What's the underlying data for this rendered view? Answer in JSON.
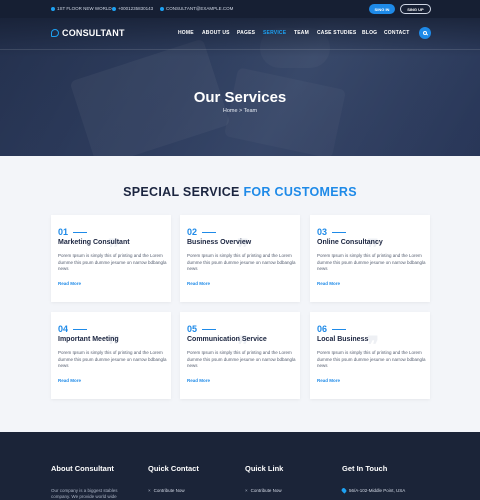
{
  "topbar": {
    "address": "1ST FLOOR NEW WORLD",
    "phone": "+0001235830143",
    "email": "CONSULTANT@EXAMPLE.COM",
    "signin_label": "SING IN",
    "signup_label": "SING UP"
  },
  "brand": {
    "name": "CONSULTANT"
  },
  "nav": {
    "items": [
      {
        "label": "HOME"
      },
      {
        "label": "ABOUT US"
      },
      {
        "label": "PAGES"
      },
      {
        "label": "SERVICE"
      },
      {
        "label": "TEAM"
      },
      {
        "label": "CASE STUDIES"
      },
      {
        "label": "BLOG"
      },
      {
        "label": "CONTACT"
      }
    ],
    "active": "SERVICE"
  },
  "hero": {
    "title": "Our Services",
    "breadcrumb": "Home > Team"
  },
  "services": {
    "title_main": "SPECIAL SERVICE ",
    "title_highlight": "FOR CUSTOMERS",
    "read_more": "Read More",
    "cards": [
      {
        "number": "01",
        "title": "Marketing Consultant",
        "description": "Porem Ipsum is simply this of printing and the Lorem dumme this psum dumme jesume on narrow bdbangla news"
      },
      {
        "number": "02",
        "title": "Business Overview",
        "description": "Porem Ipsum is simply this of printing and the Lorem dumme this psum dumme jesume on narrow bdbangla news"
      },
      {
        "number": "03",
        "title": "Online Consultancy",
        "description": "Porem Ipsum is simply this of printing and the Lorem dumme this psum dumme jesume on narrow bdbangla news"
      },
      {
        "number": "04",
        "title": "Important Meeting",
        "description": "Porem Ipsum is simply this of printing and the Lorem dumme this psum dumme jesume on narrow bdbangla news"
      },
      {
        "number": "05",
        "title": "Communication Service",
        "description": "Porem Ipsum is simply this of printing and the Lorem dumme this psum dumme jesume on narrow bdbangla news"
      },
      {
        "number": "06",
        "title": "Local Business",
        "description": "Porem Ipsum is simply this of printing and the Lorem dumme this psum dumme jesume on narrow bdbangla news"
      }
    ]
  },
  "footer": {
    "about_title": "About Consultant",
    "about_text": "Our company is a biggest stables company. We provide world wide",
    "contact_title": "Quick Contact",
    "contact_link": "Contribute Now",
    "links_title": "Quick Link",
    "links_link": "Contribute Now",
    "touch_title": "Get In Touch",
    "touch_address": "56/A-102-Middle Point, USA"
  },
  "colors": {
    "accent": "#1e8ae8",
    "dark": "#161f33",
    "footer": "#1b2438"
  }
}
